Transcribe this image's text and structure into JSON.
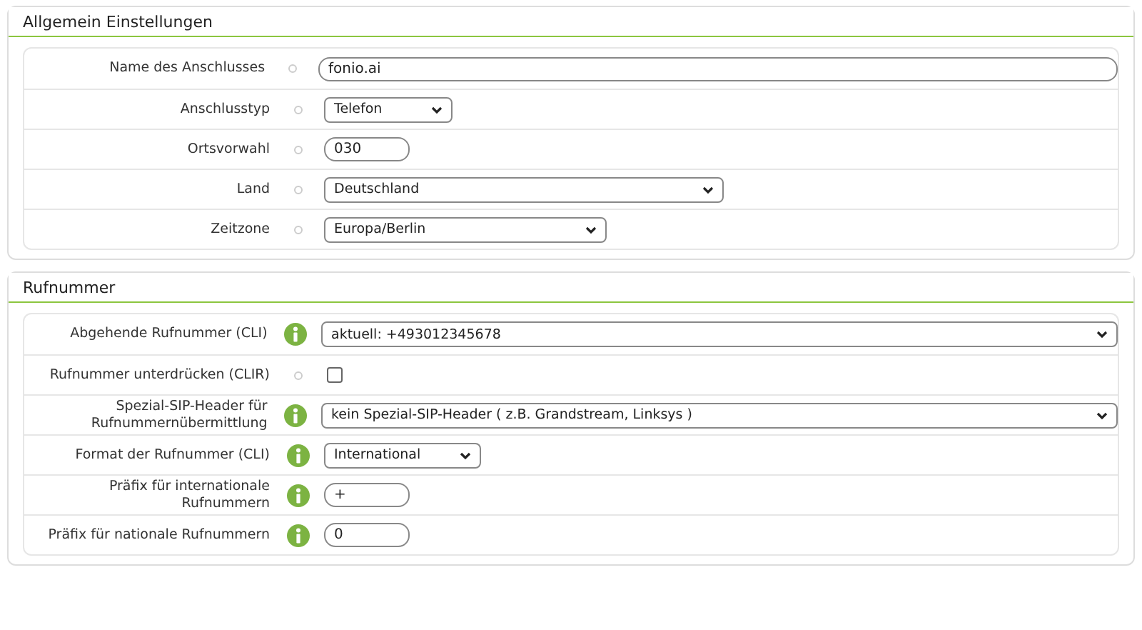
{
  "sections": [
    {
      "title": "Allgemein Einstellungen",
      "rows": [
        {
          "label": "Name des Anschlusses",
          "info": false,
          "kind": "text",
          "value": "fonio.ai"
        },
        {
          "label": "Anschlusstyp",
          "info": false,
          "kind": "select",
          "value": "Telefon"
        },
        {
          "label": "Ortsvorwahl",
          "info": false,
          "kind": "text",
          "value": "030"
        },
        {
          "label": "Land",
          "info": false,
          "kind": "select",
          "value": "Deutschland"
        },
        {
          "label": "Zeitzone",
          "info": false,
          "kind": "select",
          "value": "Europa/Berlin"
        }
      ]
    },
    {
      "title": "Rufnummer",
      "rows": [
        {
          "label": "Abgehende Rufnummer (CLI)",
          "info": true,
          "kind": "select",
          "value": "aktuell: +493012345678"
        },
        {
          "label": "Rufnummer unterdrücken (CLIR)",
          "info": false,
          "kind": "checkbox",
          "checked": false
        },
        {
          "label": "Spezial-SIP-Header für Rufnummernübermittlung",
          "info": true,
          "kind": "select",
          "value": "kein Spezial-SIP-Header ( z.B. Grandstream, Linksys )"
        },
        {
          "label": "Format der Rufnummer (CLI)",
          "info": true,
          "kind": "select",
          "value": "International"
        },
        {
          "label": "Präfix für internationale Rufnummern",
          "info": true,
          "kind": "text",
          "value": "+"
        },
        {
          "label": "Präfix für nationale Rufnummern",
          "info": true,
          "kind": "text",
          "value": "0"
        }
      ]
    }
  ]
}
